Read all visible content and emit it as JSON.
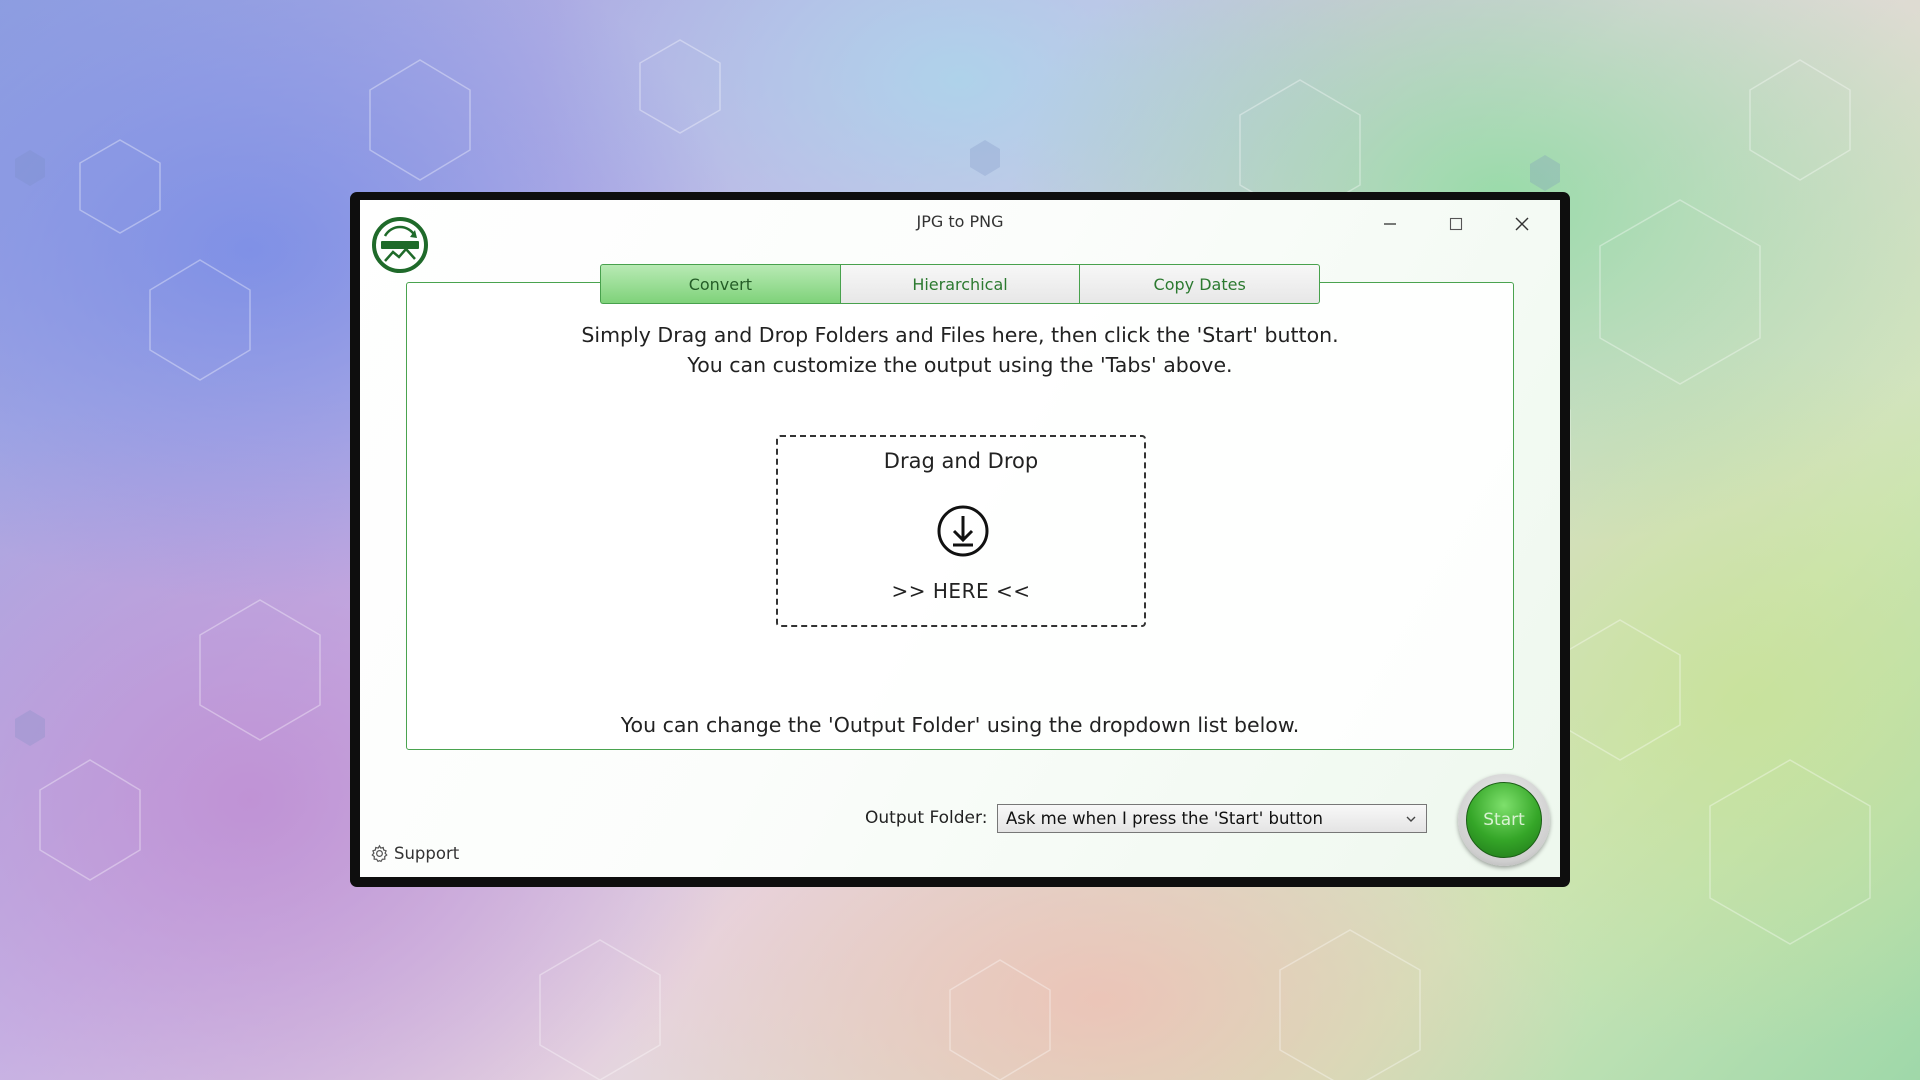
{
  "window": {
    "title": "JPG to PNG",
    "logo_icon": "jpg-to-png-logo-icon",
    "controls": {
      "minimize": "minimize-icon",
      "maximize": "maximize-icon",
      "close": "close-icon"
    }
  },
  "tabs": [
    {
      "label": "Convert",
      "active": true
    },
    {
      "label": "Hierarchical",
      "active": false
    },
    {
      "label": "Copy Dates",
      "active": false
    }
  ],
  "main": {
    "intro_line1": "Simply Drag and Drop Folders and Files here, then click the 'Start' button.",
    "intro_line2": "You can customize the output using the 'Tabs' above.",
    "dropzone": {
      "title": "Drag and Drop",
      "icon": "download-arrow-icon",
      "here": ">> HERE <<"
    },
    "output_note": "You can change the 'Output Folder' using the dropdown list below."
  },
  "footer": {
    "output_label": "Output Folder:",
    "output_value": "Ask me when I press the 'Start' button",
    "start_label": "Start",
    "support_label": "Support",
    "support_icon": "gear-icon"
  },
  "colors": {
    "accent_green": "#48a14d",
    "active_tab": "#7fd27a",
    "start_button": "#35a628",
    "window_frame": "#0e0e0e"
  }
}
